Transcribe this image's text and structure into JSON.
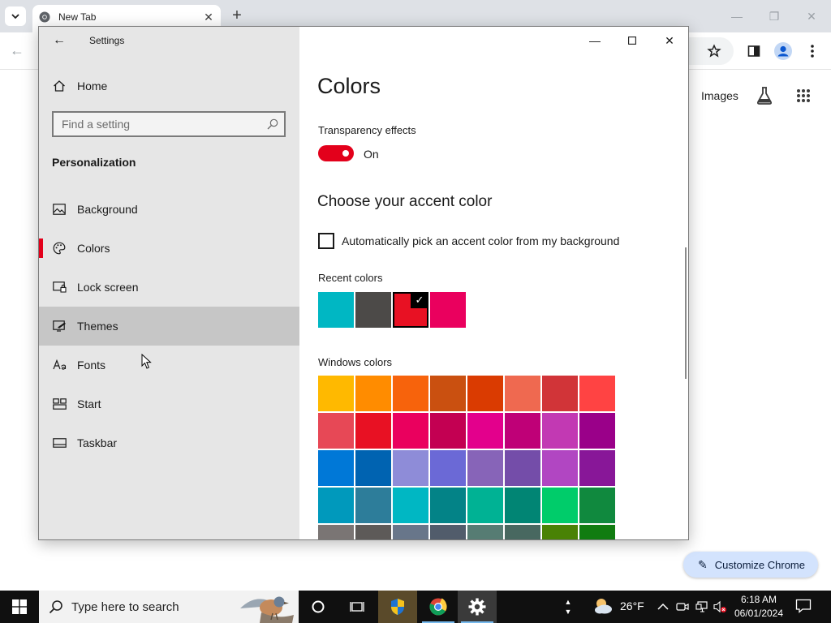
{
  "browser": {
    "tab_title": "New Tab",
    "images_link": "Images",
    "customize_button": "Customize Chrome"
  },
  "settings": {
    "window_title": "Settings",
    "home_label": "Home",
    "search_placeholder": "Find a setting",
    "section_heading": "Personalization",
    "nav_items": [
      {
        "label": "Background",
        "icon": "picture-icon"
      },
      {
        "label": "Colors",
        "icon": "palette-icon",
        "selected": true
      },
      {
        "label": "Lock screen",
        "icon": "lock-screen-icon"
      },
      {
        "label": "Themes",
        "icon": "themes-icon",
        "hovered": true
      },
      {
        "label": "Fonts",
        "icon": "fonts-icon"
      },
      {
        "label": "Start",
        "icon": "start-tiles-icon"
      },
      {
        "label": "Taskbar",
        "icon": "taskbar-icon"
      }
    ],
    "page_title": "Colors",
    "transparency_label": "Transparency effects",
    "transparency_state": "On",
    "accent_heading": "Choose your accent color",
    "auto_pick_label": "Automatically pick an accent color from my background",
    "recent_colors_label": "Recent colors",
    "recent_colors": [
      "#00b7c3",
      "#4c4a48",
      "#e81123",
      "#ea005e"
    ],
    "selected_recent_index": 2,
    "windows_colors_label": "Windows colors",
    "windows_colors": [
      "#ffb900",
      "#ff8c00",
      "#f7630c",
      "#ca5010",
      "#da3b01",
      "#ef6950",
      "#d13438",
      "#ff4343",
      "#e74856",
      "#e81123",
      "#ea005e",
      "#c30052",
      "#e3008c",
      "#bf0077",
      "#c239b3",
      "#9a0089",
      "#0078d7",
      "#0063b1",
      "#8e8cd8",
      "#6b69d6",
      "#8764b8",
      "#744da9",
      "#b146c2",
      "#881798",
      "#0099bc",
      "#2d7d9a",
      "#00b7c3",
      "#038387",
      "#00b294",
      "#018574",
      "#00cc6a",
      "#10893e",
      "#7a7574",
      "#5d5a58",
      "#68768a",
      "#515c6b",
      "#567c73",
      "#486860",
      "#498205",
      "#107c10"
    ],
    "accent_color": "#e81123"
  },
  "taskbar": {
    "search_placeholder": "Type here to search",
    "temperature": "26°F",
    "time": "6:18 AM",
    "date": "06/01/2024"
  }
}
